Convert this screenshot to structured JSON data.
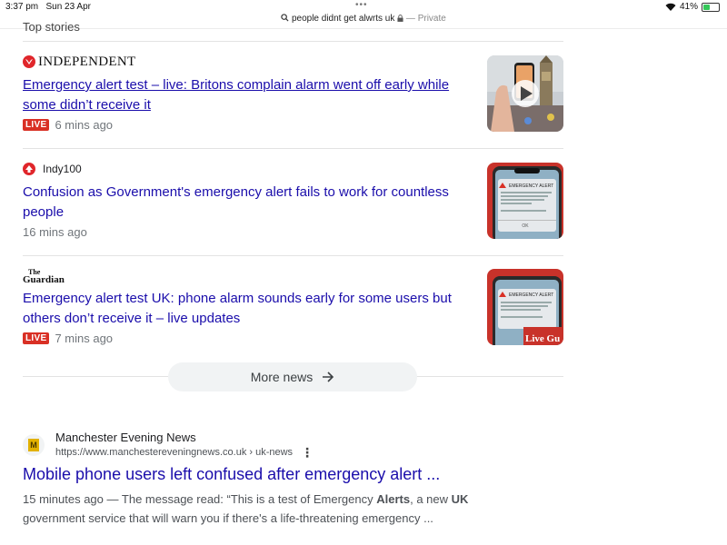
{
  "status_bar": {
    "time": "3:37 pm",
    "date": "Sun 23 Apr",
    "url": "people didnt get alwrts uk",
    "private_label": "Private",
    "battery": "41%",
    "battery_level": 0.41
  },
  "partial_heading": "Top stories",
  "news_items": [
    {
      "source": "INDEPENDENT",
      "headline": "Emergency alert test – live: Britons complain alarm went off early while some didn’t receive it",
      "live_badge": "LIVE",
      "time": "6 mins ago"
    },
    {
      "source": "Indy100",
      "headline": "Confusion as Government's emergency alert fails to work for countless people",
      "time": "16 mins ago"
    },
    {
      "source_line1": "The",
      "source_line2": "Guardian",
      "headline": "Emergency alert test UK: phone alarm sounds early for some users but others don’t receive it – live updates",
      "live_badge": "LIVE",
      "time": "7 mins ago",
      "thumb_overlay": "Live Gu"
    }
  ],
  "thumb_alert": {
    "title": "EMERGENCY ALERT",
    "ok": "OK"
  },
  "more_news": "More news",
  "result": {
    "favicon_letter": "M",
    "site_name": "Manchester Evening News",
    "site_url": "https://www.manchestereveningnews.co.uk › uk-news",
    "title": "Mobile phone users left confused after emergency alert ...",
    "snippet_time": "15 minutes ago",
    "snippet_part1": " — The message read: “This is a test of Emergency ",
    "snippet_bold1": "Alerts",
    "snippet_part2": ", a new ",
    "snippet_bold2": "UK",
    "snippet_part3": " government service that will warn you if there's a life-threatening emergency ..."
  },
  "colors": {
    "link": "#1a0dab",
    "live_red": "#d93025",
    "independent_red": "#e0262b"
  }
}
